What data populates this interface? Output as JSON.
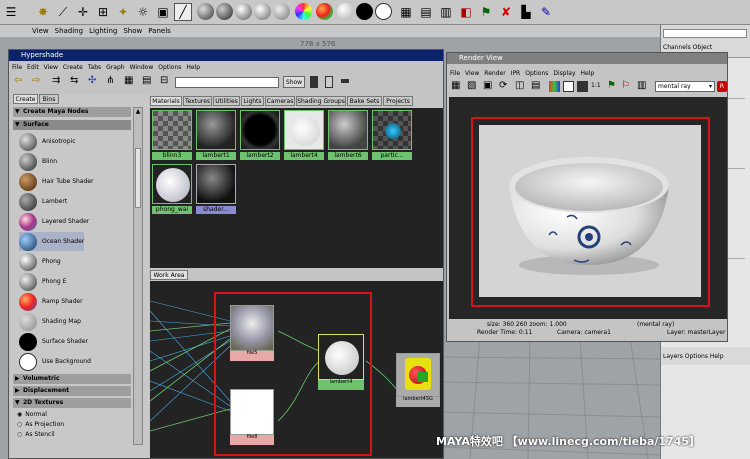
{
  "viewport": {
    "menu": [
      "View",
      "Shading",
      "Lighting",
      "Show",
      "Panels"
    ],
    "resolution": "778 x 576"
  },
  "hypershade": {
    "title": "Hypershade",
    "menu": [
      "File",
      "Edit",
      "View",
      "Create",
      "Tabs",
      "Graph",
      "Window",
      "Options",
      "Help"
    ],
    "show_button": "Show",
    "left_tabs": [
      "Create",
      "Bins"
    ],
    "create_header": "Create Maya Nodes",
    "surface_header": "Surface",
    "surface_items": [
      "Anisotropic",
      "Blinn",
      "Hair Tube Shader",
      "Lambert",
      "Layered Shader",
      "Ocean Shader",
      "Phong",
      "Phong E",
      "Ramp Shader",
      "Shading Map",
      "Surface Shader",
      "Use Background"
    ],
    "sections": [
      "Volumetric",
      "Displacement",
      "2D Textures"
    ],
    "radios": [
      "Normal",
      "As Projection",
      "As Stencil"
    ],
    "top_tabs": [
      "Materials",
      "Textures",
      "Utilities",
      "Lights",
      "Cameras",
      "Shading Groups",
      "Bake Sets",
      "Projects"
    ],
    "materials": [
      "blinn3",
      "lambert1",
      "lambert2",
      "lambert4",
      "lambert6",
      "partic...",
      "phong_wai",
      "shader..."
    ],
    "work_area_tab": "Work Area",
    "work_nodes": [
      "file5",
      "file8",
      "lambert4",
      "lambert4SG"
    ]
  },
  "render_view": {
    "title": "Render View",
    "menu": [
      "File",
      "View",
      "Render",
      "IPR",
      "Options",
      "Display",
      "Help"
    ],
    "renderer": "mental ray",
    "ratio": "1:1",
    "status1": "size: 360 260 zoom: 1.000",
    "status1b": "(mental ray)",
    "status2": "Render Time: 0:11",
    "status2b": "Camera: camera1",
    "status2c": "Layer: masterLayer"
  },
  "right_panel": {
    "channels": "Channels Object",
    "layers": "Layers Options Help"
  },
  "watermark": "MAYA特效吧 【www.linecg.com/tieba/1745】",
  "colors": {
    "selection_red": "#d41418",
    "material_label_green": "#6ec46e",
    "titlebar_blue": "#0a246a"
  }
}
